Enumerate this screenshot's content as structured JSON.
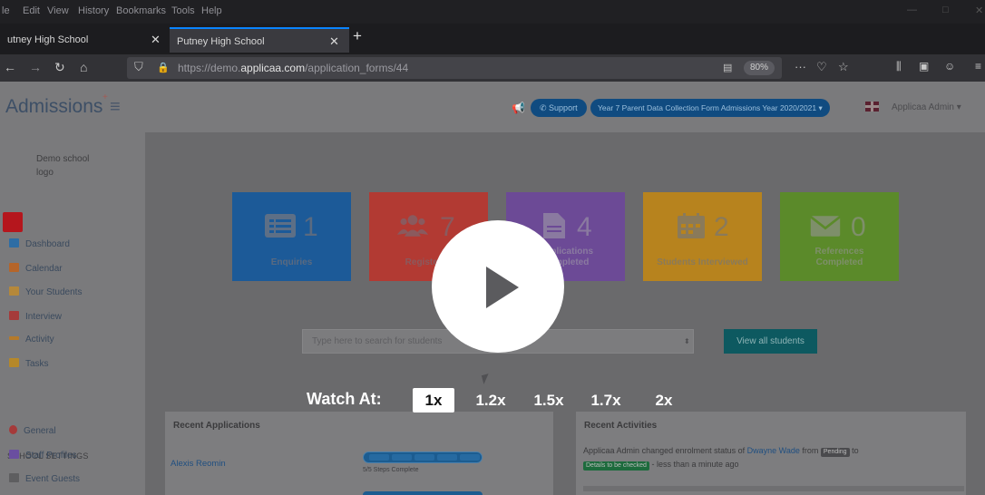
{
  "menubar": {
    "items": [
      "le",
      "Edit",
      "View",
      "History",
      "Bookmarks",
      "Tools",
      "Help"
    ]
  },
  "tabs": {
    "tab1_label": "utney High School",
    "tab2_label": "Putney High School",
    "new_tab": "+"
  },
  "navbar": {
    "url_prefix": "https://demo.",
    "url_domain": "applicaa.com",
    "url_path": "/application_forms/44",
    "zoom": "80%",
    "more": "···"
  },
  "header": {
    "brand": "Admissions",
    "support_label": "Support",
    "form_selector": "Year 7 Parent Data Collection Form Admissions Year 2020/2021",
    "user": "Applicaa Admin"
  },
  "sidebar": {
    "logo_text": "Demo school logo",
    "items": [
      {
        "label": "Dashboard",
        "color": "#2e6da4"
      },
      {
        "label": "Calendar",
        "color": "#b5652a"
      },
      {
        "label": "Your Students",
        "color": "#b5883a"
      },
      {
        "label": "Interview",
        "color": "#a53a3a"
      },
      {
        "label": "Activity",
        "color": "#b57a2a"
      },
      {
        "label": "Tasks",
        "color": "#b5882a"
      }
    ],
    "settings_heading": "SCHOOL SETTINGS",
    "settings_items": [
      {
        "label": "General",
        "color": "#a53a3a"
      },
      {
        "label": "Staff Profiles",
        "color": "#6a4ea0"
      },
      {
        "label": "Event Guests",
        "color": "#7a7a7c"
      }
    ]
  },
  "tiles": [
    {
      "value": "1",
      "label": "Enquiries",
      "color": "#1c5a98",
      "icon": "list-icon"
    },
    {
      "value": "7",
      "label": "Registered",
      "color": "#b23a33",
      "icon": "users-icon"
    },
    {
      "value": "4",
      "label": "Applications Completed",
      "color": "#6c4a96",
      "icon": "document-icon"
    },
    {
      "value": "2",
      "label": "Students Interviewed",
      "color": "#b7831e",
      "icon": "calendar-icon"
    },
    {
      "value": "0",
      "label": "References Completed",
      "color": "#5b8a2a",
      "icon": "envelope-icon"
    }
  ],
  "search": {
    "placeholder": "Type here to search for students",
    "button_label": "View all students"
  },
  "recent_applications": {
    "title": "Recent Applications",
    "row_name": "Alexis Reomin",
    "steps_text": "5/5 Steps Complete"
  },
  "recent_activities": {
    "title": "Recent Activities",
    "actor": "Applicaa Admin",
    "verb": "changed enrolment status of",
    "student": "Dwayne Wade",
    "from": "from",
    "status_from": "Pending",
    "to": "to",
    "status_to": "Details to be checked",
    "when": "- less than a minute ago"
  },
  "video": {
    "watch_label": "Watch At:",
    "speeds": [
      "1x",
      "1.2x",
      "1.5x",
      "1.7x",
      "2x"
    ],
    "active_speed": "1x"
  }
}
